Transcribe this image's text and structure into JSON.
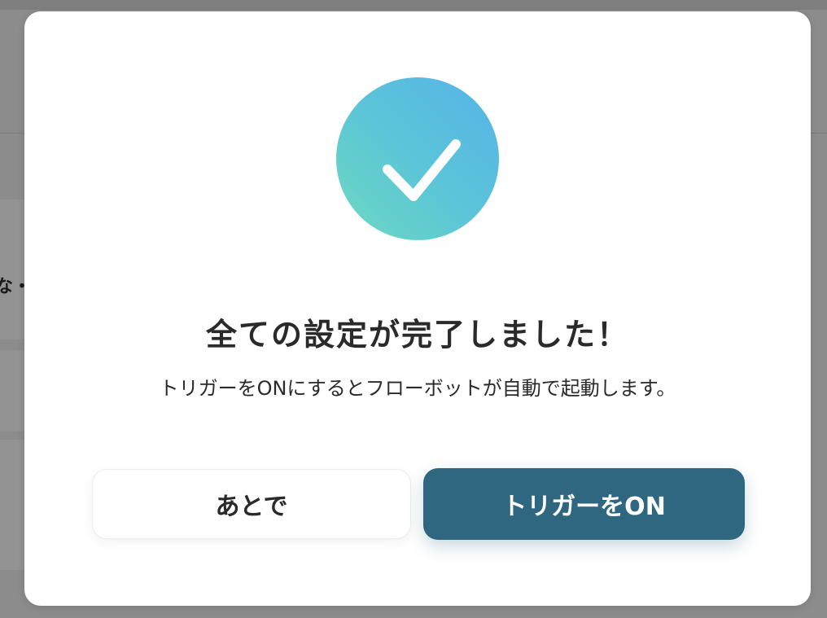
{
  "background": {
    "partial_text": "な・"
  },
  "modal": {
    "icon": "checkmark-icon",
    "title": "全ての設定が完了しました！",
    "description": "トリガーをONにするとフローボットが自動で起動します。",
    "buttons": {
      "later_label": "あとで",
      "trigger_on_label": "トリガーをON"
    }
  },
  "colors": {
    "primary_button": "#2f6780",
    "check_gradient_start": "#6ddac1",
    "check_gradient_end": "#57b3ea"
  }
}
